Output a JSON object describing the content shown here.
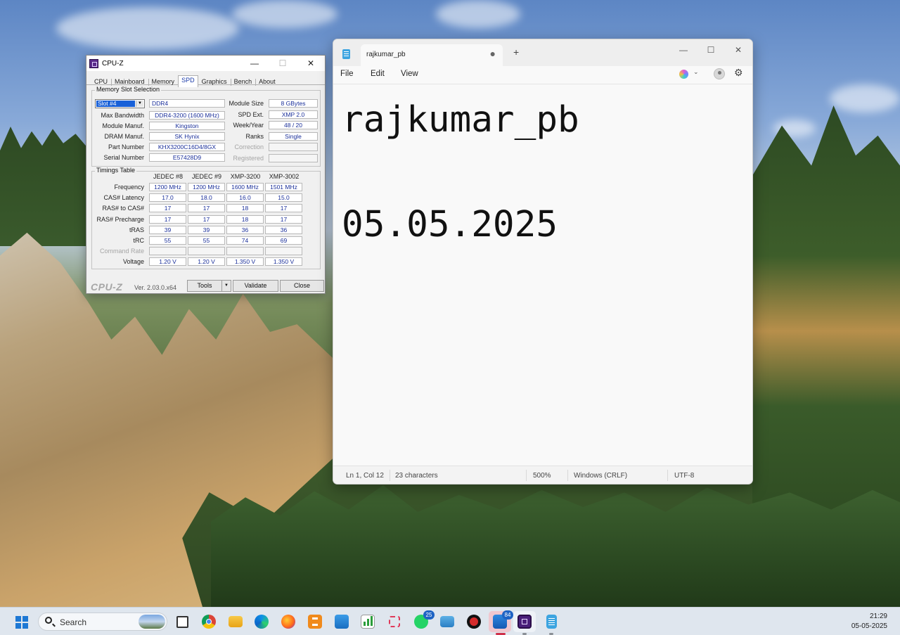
{
  "cpuz": {
    "title": "CPU-Z",
    "controls": {
      "minimize": "—",
      "maximize": "☐",
      "close": "✕"
    },
    "tabs": [
      "CPU",
      "Mainboard",
      "Memory",
      "SPD",
      "Graphics",
      "Bench",
      "About"
    ],
    "active_tab": "SPD",
    "slot_group_title": "Memory Slot Selection",
    "slot_selected": "Slot #4",
    "memory_type": "DDR4",
    "left_rows": [
      {
        "label": "Max Bandwidth",
        "value": "DDR4-3200 (1600 MHz)"
      },
      {
        "label": "Module Manuf.",
        "value": "Kingston"
      },
      {
        "label": "DRAM Manuf.",
        "value": "SK Hynix"
      },
      {
        "label": "Part Number",
        "value": "KHX3200C16D4/8GX"
      },
      {
        "label": "Serial Number",
        "value": "E57428D9"
      }
    ],
    "right_rows": [
      {
        "label": "Module Size",
        "value": "8 GBytes",
        "dim": false
      },
      {
        "label": "SPD Ext.",
        "value": "XMP 2.0",
        "dim": false
      },
      {
        "label": "Week/Year",
        "value": "48 / 20",
        "dim": false
      },
      {
        "label": "Ranks",
        "value": "Single",
        "dim": false
      },
      {
        "label": "Correction",
        "value": "",
        "dim": true
      },
      {
        "label": "Registered",
        "value": "",
        "dim": true
      }
    ],
    "timings_title": "Timings Table",
    "timing_columns": [
      "JEDEC #8",
      "JEDEC #9",
      "XMP-3200",
      "XMP-3002"
    ],
    "timing_rows": [
      {
        "label": "Frequency",
        "values": [
          "1200 MHz",
          "1200 MHz",
          "1600 MHz",
          "1501 MHz"
        ],
        "dim": false
      },
      {
        "label": "CAS# Latency",
        "values": [
          "17.0",
          "18.0",
          "16.0",
          "15.0"
        ],
        "dim": false
      },
      {
        "label": "RAS# to CAS#",
        "values": [
          "17",
          "17",
          "18",
          "17"
        ],
        "dim": false
      },
      {
        "label": "RAS# Precharge",
        "values": [
          "17",
          "17",
          "18",
          "17"
        ],
        "dim": false
      },
      {
        "label": "tRAS",
        "values": [
          "39",
          "39",
          "36",
          "36"
        ],
        "dim": false
      },
      {
        "label": "tRC",
        "values": [
          "55",
          "55",
          "74",
          "69"
        ],
        "dim": false
      },
      {
        "label": "Command Rate",
        "values": [
          "",
          "",
          "",
          ""
        ],
        "dim": true
      },
      {
        "label": "Voltage",
        "values": [
          "1.20 V",
          "1.20 V",
          "1.350 V",
          "1.350 V"
        ],
        "dim": false
      }
    ],
    "footer": {
      "logo": "CPU-Z",
      "version": "Ver. 2.03.0.x64",
      "tools": "Tools",
      "validate": "Validate",
      "close": "Close"
    }
  },
  "notepad": {
    "tab_title": "rajkumar_pb",
    "tab_modified_dot": "●",
    "new_tab": "+",
    "controls": {
      "minimize": "—",
      "maximize": "☐",
      "close": "✕"
    },
    "menu": [
      "File",
      "Edit",
      "View"
    ],
    "content_lines": [
      "rajkumar_pb",
      "05.05.2025"
    ],
    "status": {
      "position": "Ln 1, Col 12",
      "characters": "23 characters",
      "zoom": "500%",
      "line_endings": "Windows (CRLF)",
      "encoding": "UTF-8"
    }
  },
  "taskbar": {
    "search_label": "Search",
    "whatsapp_badge": "25",
    "remote_badge": "84",
    "time": "21:29",
    "date": "05-05-2025",
    "icons": [
      "task-view",
      "chrome",
      "file-explorer",
      "edge",
      "firefox",
      "sublime-text",
      "cloud-app",
      "chart-app",
      "snipping-tool",
      "whatsapp",
      "keyboard-app",
      "media-app",
      "remote-app",
      "cpuz",
      "notepad"
    ]
  }
}
